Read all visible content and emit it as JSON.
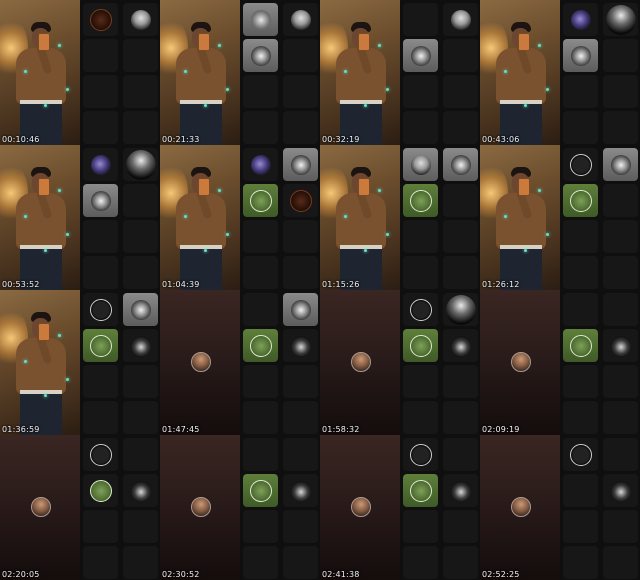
{
  "tiles": [
    {
      "time": "00:10:46",
      "video": "photo",
      "cells": [
        [
          "ember"
        ],
        [
          "face"
        ],
        [],
        [],
        [],
        [],
        [],
        []
      ],
      "cellbg": [
        "",
        "",
        "",
        "",
        "",
        "",
        "",
        ""
      ]
    },
    {
      "time": "00:21:33",
      "video": "photo",
      "cells": [
        [
          "flower"
        ],
        [
          "face"
        ],
        [
          "mono"
        ],
        [],
        [],
        [],
        [],
        []
      ],
      "cellbg": [
        "gray",
        "",
        "gray",
        "",
        "",
        "",
        "",
        ""
      ]
    },
    {
      "time": "00:32:19",
      "video": "photo",
      "cells": [
        [],
        [
          "face"
        ],
        [
          "mono"
        ],
        [],
        [],
        [],
        [],
        []
      ],
      "cellbg": [
        "",
        "",
        "gray",
        "",
        "",
        "",
        "",
        ""
      ]
    },
    {
      "time": "00:43:06",
      "video": "photo",
      "cells": [
        [
          "purple"
        ],
        [
          "dark"
        ],
        [
          "mono"
        ],
        [],
        [],
        [],
        [],
        []
      ],
      "cellbg": [
        "",
        "",
        "gray",
        "",
        "",
        "",
        "",
        ""
      ]
    },
    {
      "time": "00:53:52",
      "video": "photo",
      "cells": [
        [
          "purple"
        ],
        [
          "dark"
        ],
        [
          "mono"
        ],
        [],
        [],
        [],
        [],
        []
      ],
      "cellbg": [
        "",
        "",
        "gray",
        "",
        "",
        "",
        "",
        ""
      ]
    },
    {
      "time": "01:04:39",
      "video": "photo",
      "cells": [
        [
          "purple"
        ],
        [
          "mono"
        ],
        [
          "seal-g"
        ],
        [
          "ember"
        ],
        [],
        [],
        [],
        []
      ],
      "cellbg": [
        "",
        "gray",
        "green",
        "",
        "",
        "",
        "",
        ""
      ]
    },
    {
      "time": "01:15:26",
      "video": "photo",
      "cells": [
        [
          "face"
        ],
        [
          "mono"
        ],
        [
          "seal-g"
        ],
        [],
        [],
        [],
        [],
        []
      ],
      "cellbg": [
        "gray",
        "gray",
        "green",
        "",
        "",
        "",
        "",
        ""
      ]
    },
    {
      "time": "01:26:12",
      "video": "photo",
      "cells": [
        [
          "seal"
        ],
        [
          "mono"
        ],
        [
          "seal-g"
        ],
        [],
        [],
        [],
        [],
        []
      ],
      "cellbg": [
        "",
        "gray",
        "green",
        "",
        "",
        "",
        "",
        ""
      ]
    },
    {
      "time": "01:36:59",
      "video": "photo",
      "cells": [
        [
          "seal"
        ],
        [
          "mono"
        ],
        [
          "seal-g"
        ],
        [
          "cat"
        ],
        [],
        [],
        [],
        []
      ],
      "cellbg": [
        "",
        "gray",
        "green",
        "",
        "",
        "",
        "",
        ""
      ]
    },
    {
      "time": "01:47:45",
      "video": "call",
      "cells": [
        [],
        [
          "mono"
        ],
        [
          "seal-g"
        ],
        [
          "cat"
        ],
        [],
        [],
        [],
        []
      ],
      "cellbg": [
        "",
        "gray",
        "green",
        "",
        "",
        "",
        "",
        ""
      ]
    },
    {
      "time": "01:58:32",
      "video": "call",
      "cells": [
        [
          "seal"
        ],
        [
          "dark"
        ],
        [
          "seal-g"
        ],
        [
          "cat"
        ],
        [],
        [],
        [],
        []
      ],
      "cellbg": [
        "",
        "",
        "green",
        "",
        "",
        "",
        "",
        ""
      ]
    },
    {
      "time": "02:09:19",
      "video": "call",
      "cells": [
        [],
        [],
        [
          "seal-g"
        ],
        [
          "cat"
        ],
        [],
        [],
        [],
        []
      ],
      "cellbg": [
        "",
        "",
        "green",
        "",
        "",
        "",
        "",
        ""
      ]
    },
    {
      "time": "02:20:05",
      "video": "call",
      "cells": [
        [
          "seal"
        ],
        [],
        [
          "seal-g"
        ],
        [
          "cat"
        ],
        [],
        [],
        [],
        []
      ],
      "cellbg": [
        "",
        "",
        "",
        "",
        "",
        "",
        "",
        ""
      ]
    },
    {
      "time": "02:30:52",
      "video": "call",
      "cells": [
        [],
        [],
        [
          "seal-g"
        ],
        [
          "cat"
        ],
        [],
        [],
        [],
        []
      ],
      "cellbg": [
        "",
        "",
        "green",
        "",
        "",
        "",
        "",
        ""
      ]
    },
    {
      "time": "02:41:38",
      "video": "call",
      "cells": [
        [
          "seal"
        ],
        [],
        [
          "seal-g"
        ],
        [
          "cat"
        ],
        [],
        [],
        [],
        []
      ],
      "cellbg": [
        "",
        "",
        "green",
        "",
        "",
        "",
        "",
        ""
      ]
    },
    {
      "time": "02:52:25",
      "video": "call",
      "cells": [
        [
          "seal"
        ],
        [],
        [],
        [
          "cat"
        ],
        [],
        [],
        [],
        []
      ],
      "cellbg": [
        "",
        "",
        "",
        "",
        "",
        "",
        "",
        ""
      ]
    }
  ]
}
